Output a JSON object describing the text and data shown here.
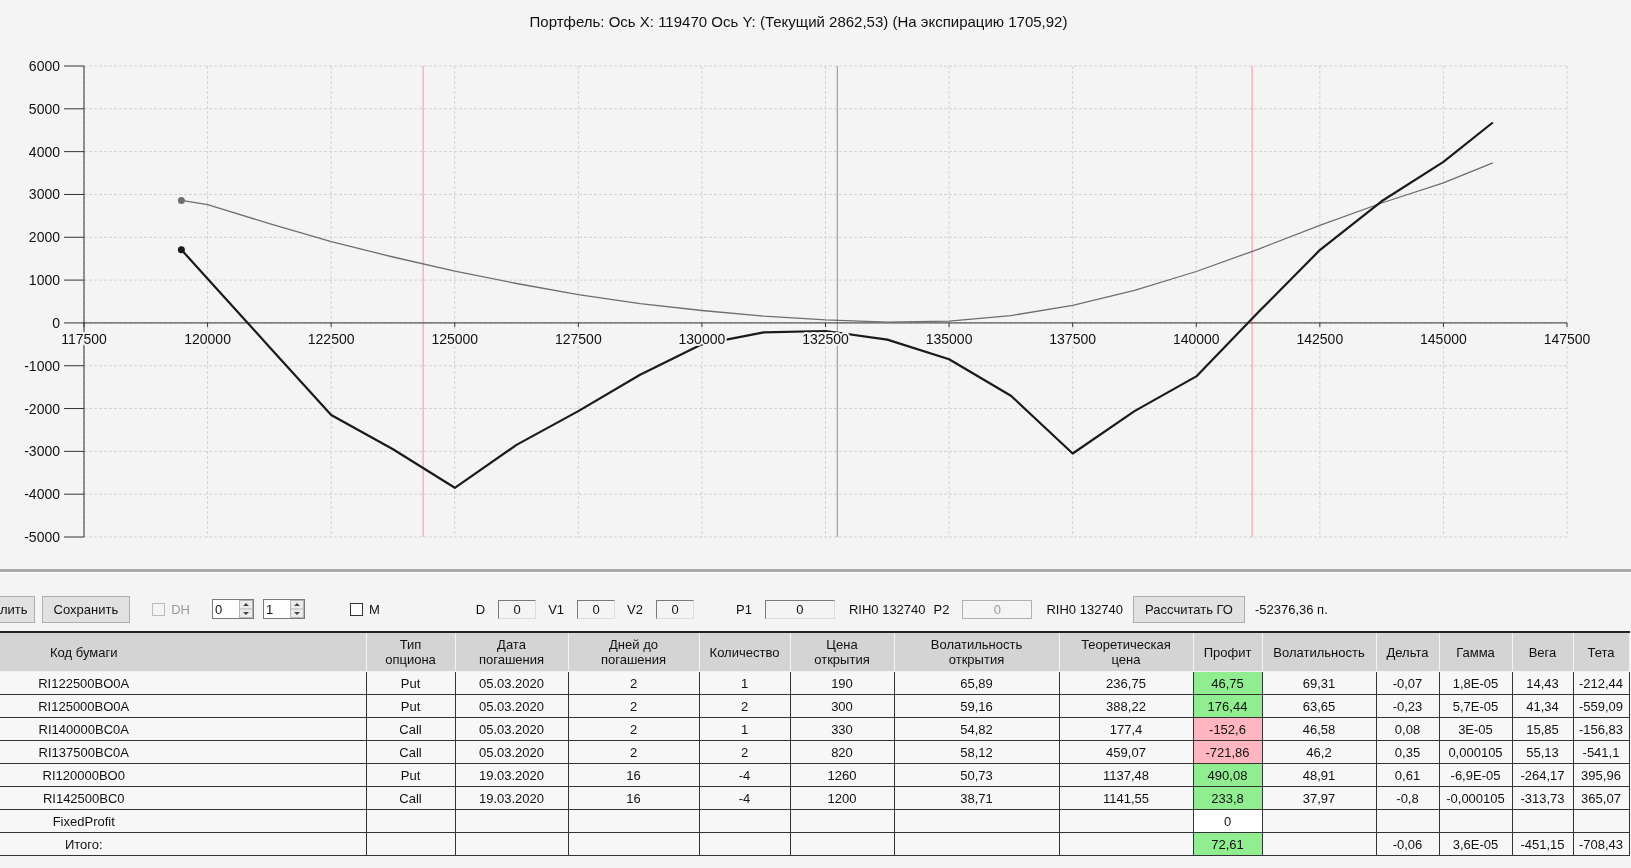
{
  "chart": {
    "title": "Портфель: Ось X: 119470 Ось Y:  (Текущий 2862,53)  (На экспирацию 1705,92)",
    "chart_data": {
      "type": "line",
      "x": [
        119470,
        120000,
        121250,
        122500,
        123750,
        125000,
        126250,
        127500,
        128750,
        130000,
        131250,
        132500,
        133750,
        135000,
        136250,
        137500,
        138750,
        140000,
        141250,
        142500,
        143750,
        145000,
        146000
      ],
      "series": [
        {
          "color": "#6e6e6e",
          "values": [
            2860,
            2760,
            2320,
            1900,
            1540,
            1210,
            920,
            660,
            450,
            290,
            160,
            70,
            20,
            40,
            170,
            410,
            760,
            1200,
            1720,
            2280,
            2800,
            3270,
            3740
          ]
        },
        {
          "color": "#1a1a1a",
          "values": [
            1710,
            1030,
            -560,
            -2150,
            -2950,
            -3850,
            -2850,
            -2060,
            -1210,
            -500,
            -220,
            -190,
            -390,
            -850,
            -1700,
            -3050,
            -2060,
            -1250,
            240,
            1700,
            2840,
            3760,
            4680
          ]
        }
      ],
      "xlim": [
        117500,
        147500
      ],
      "ylim": [
        -5000,
        6000
      ],
      "xticks": [
        117500,
        120000,
        122500,
        125000,
        127500,
        130000,
        132500,
        135000,
        137500,
        140000,
        142500,
        145000,
        147500
      ],
      "yticks": [
        -5000,
        -4000,
        -3000,
        -2000,
        -1000,
        0,
        1000,
        2000,
        3000,
        4000,
        5000,
        6000
      ],
      "grid": true,
      "ref_lines": [
        {
          "axis": "x",
          "value": 124360,
          "color": "#ffa0a8"
        },
        {
          "axis": "x",
          "value": 132740,
          "color": "#9aa0b8"
        },
        {
          "axis": "x",
          "value": 141130,
          "color": "#ffa0a8"
        }
      ]
    }
  },
  "toolbar": {
    "items": [
      {
        "kind": "button",
        "label": "лить"
      },
      {
        "kind": "button",
        "label": "Сохранить"
      },
      {
        "kind": "checkbox",
        "label": "DH",
        "checked": false,
        "disabled": true
      },
      {
        "kind": "spinner",
        "value": "0"
      },
      {
        "kind": "spinner",
        "value": "1"
      },
      {
        "kind": "checkbox",
        "label": "M",
        "checked": false,
        "disabled": false
      },
      {
        "kind": "field",
        "label": "D",
        "value": "0",
        "disabled": false
      },
      {
        "kind": "field",
        "label": "V1",
        "value": "0",
        "disabled": false
      },
      {
        "kind": "field",
        "label": "V2",
        "value": "0",
        "disabled": false
      },
      {
        "kind": "field",
        "label": "P1",
        "value": "0",
        "disabled": false
      },
      {
        "kind": "text",
        "text": "RIH0 132740"
      },
      {
        "kind": "field",
        "label": "P2",
        "value": "0",
        "disabled": true
      },
      {
        "kind": "text",
        "text": "RIH0 132740"
      },
      {
        "kind": "button",
        "label": "Рассчитать ГО"
      },
      {
        "kind": "text",
        "text": "-52376,36 п."
      }
    ]
  },
  "table": {
    "columns": [
      "Код бумаги",
      "Тип\nопциона",
      "Дата\nпогашения",
      "Дней до\nпогашения",
      "Количество",
      "Цена\nоткрытия",
      "Волатильность\nоткрытия",
      "Теоретическая\nцена",
      "Профит",
      "Волатильность",
      "Дельта",
      "Гамма",
      "Вега",
      "Тета"
    ],
    "rows": [
      {
        "cells": [
          "RI122500BO0A",
          "Put",
          "05.03.2020",
          "2",
          "1",
          "190",
          "65,89",
          "236,75",
          "46,75",
          "69,31",
          "-0,07",
          "1,8E-05",
          "14,43",
          "-212,44"
        ],
        "color": "#90ee90"
      },
      {
        "cells": [
          "RI125000BO0A",
          "Put",
          "05.03.2020",
          "2",
          "2",
          "300",
          "59,16",
          "388,22",
          "176,44",
          "63,65",
          "-0,23",
          "5,7E-05",
          "41,34",
          "-559,09"
        ],
        "color": "#90ee90"
      },
      {
        "cells": [
          "RI140000BC0A",
          "Call",
          "05.03.2020",
          "2",
          "1",
          "330",
          "54,82",
          "177,4",
          "-152,6",
          "46,58",
          "0,08",
          "3E-05",
          "15,85",
          "-156,83"
        ],
        "color": "#ffb6c1"
      },
      {
        "cells": [
          "RI137500BC0A",
          "Call",
          "05.03.2020",
          "2",
          "2",
          "820",
          "58,12",
          "459,07",
          "-721,86",
          "46,2",
          "0,35",
          "0,000105",
          "55,13",
          "-541,1"
        ],
        "color": "#ffb6c1"
      },
      {
        "cells": [
          "RI120000BO0",
          "Put",
          "19.03.2020",
          "16",
          "-4",
          "1260",
          "50,73",
          "1137,48",
          "490,08",
          "48,91",
          "0,61",
          "-6,9E-05",
          "-264,17",
          "395,96"
        ],
        "color": "#90ee90"
      },
      {
        "cells": [
          "RI142500BC0",
          "Call",
          "19.03.2020",
          "16",
          "-4",
          "1200",
          "38,71",
          "1141,55",
          "233,8",
          "37,97",
          "-0,8",
          "-0,000105",
          "-313,73",
          "365,07"
        ],
        "color": "#90ee90"
      },
      {
        "cells": [
          "FixedProfit",
          null,
          null,
          null,
          null,
          null,
          null,
          null,
          "0",
          null,
          null,
          null,
          null,
          null
        ]
      },
      {
        "cells": [
          "Итого:",
          null,
          null,
          null,
          null,
          null,
          null,
          null,
          "72,61",
          null,
          "-0,06",
          "3,6E-05",
          "-451,15",
          "-708,43"
        ],
        "color": "#90ee90"
      }
    ]
  }
}
